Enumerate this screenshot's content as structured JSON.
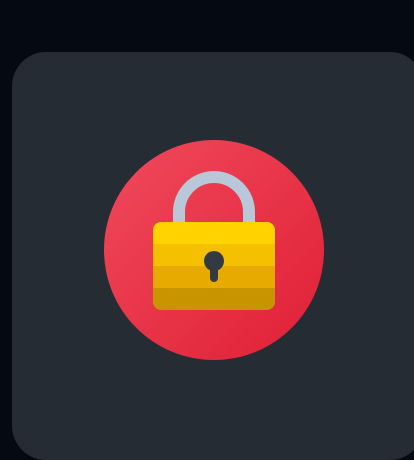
{
  "icon": {
    "name": "lock-icon",
    "colors": {
      "background": "#050a12",
      "card": "#262c33",
      "circle_light": "#f04a5c",
      "circle_dark": "#e01f35",
      "shackle": "#b8c8d8",
      "body_top": "#ffd200",
      "body_mid1": "#f4c000",
      "body_mid2": "#e6aa00",
      "body_bottom": "#c89400",
      "keyhole": "#333a42"
    }
  }
}
